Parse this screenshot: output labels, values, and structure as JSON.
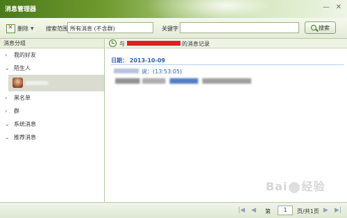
{
  "window": {
    "title": "消息管理器"
  },
  "toolbar": {
    "delete_label": "删除",
    "scope_label": "搜索范围",
    "scope_value": "所有消息 (不含群)",
    "keyword_label": "关键字",
    "keyword_value": "",
    "search_label": "搜索"
  },
  "sidebar": {
    "header": "消息分组",
    "groups": [
      {
        "label": "我的好友"
      },
      {
        "label": "陌生人"
      },
      {
        "label": "黑名单"
      },
      {
        "label": "群"
      },
      {
        "label": "系统消息"
      },
      {
        "label": "推荐消息"
      }
    ]
  },
  "main": {
    "header_prefix": "与",
    "header_suffix": "的消息记录",
    "date": "日期： 2013-10-09",
    "message_meta": "说：(13:53:05)"
  },
  "pager": {
    "first": "|◀",
    "prev": "◀",
    "next": "▶",
    "last": "▶|",
    "page_prefix": "第",
    "page_value": "1",
    "page_suffix": "页/共1页"
  },
  "watermark": {
    "text_left": "Bai",
    "text_right": "经验"
  }
}
